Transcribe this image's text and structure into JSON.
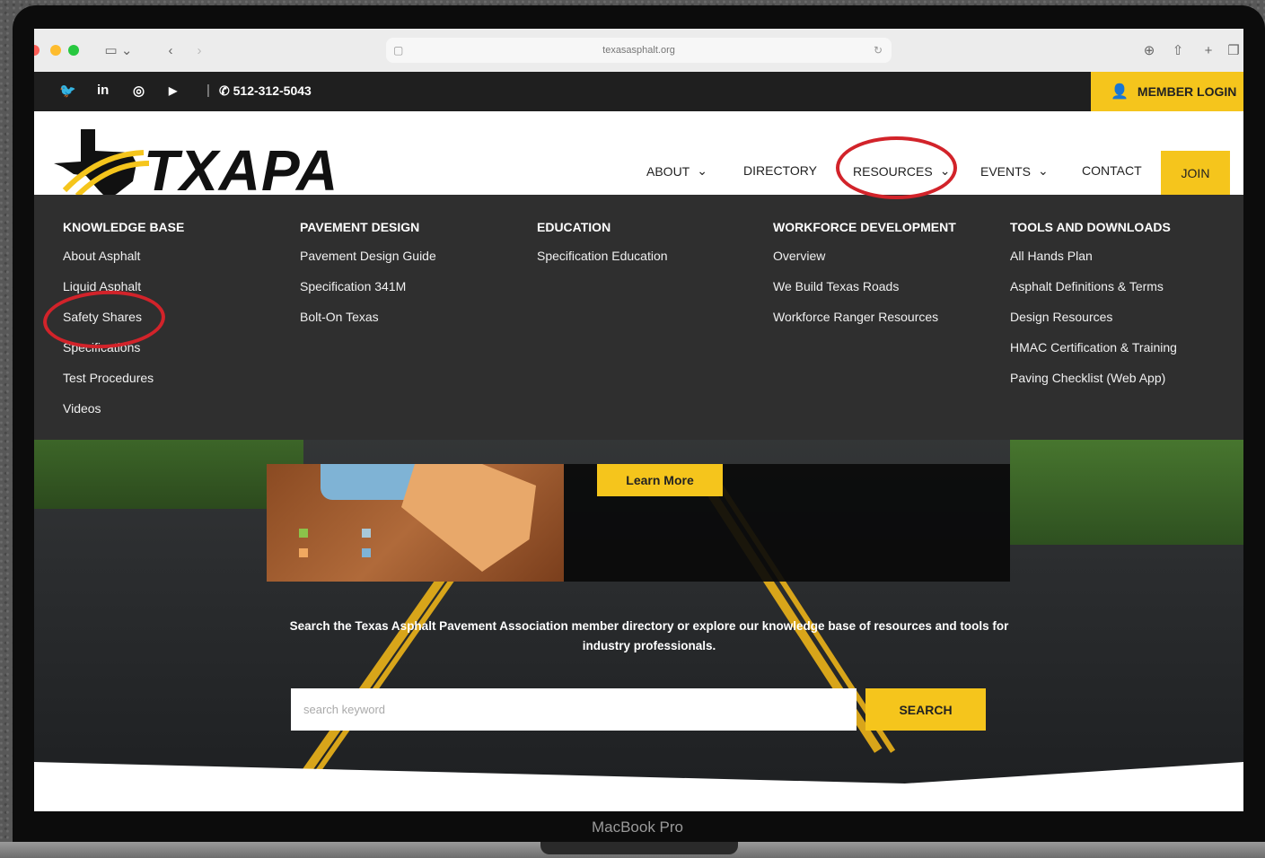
{
  "browser": {
    "url": "texasasphalt.org"
  },
  "topbar": {
    "social": [
      "twitter-icon",
      "linkedin-icon",
      "instagram-icon",
      "youtube-icon"
    ],
    "social_glyphs": [
      "🐦",
      "in",
      "◎",
      "▶"
    ],
    "separator": "|",
    "phone": "512-312-5043",
    "member_login": "MEMBER LOGIN"
  },
  "header": {
    "logo_text": "TXAPA",
    "nav": {
      "about": "ABOUT",
      "directory": "DIRECTORY",
      "resources": "RESOURCES",
      "events": "EVENTS",
      "contact": "CONTACT",
      "join": "JOIN"
    }
  },
  "mega_menu": {
    "columns": [
      {
        "heading": "KNOWLEDGE BASE",
        "links": [
          "About Asphalt",
          "Liquid Asphalt",
          "Safety Shares",
          "Specifications",
          "Test Procedures",
          "Videos"
        ]
      },
      {
        "heading": "PAVEMENT DESIGN",
        "links": [
          "Pavement Design Guide",
          "Specification 341M",
          "Bolt-On Texas"
        ]
      },
      {
        "heading": "EDUCATION",
        "links": [
          "Specification Education"
        ]
      },
      {
        "heading": "WORKFORCE DEVELOPMENT",
        "links": [
          "Overview",
          "We Build Texas Roads",
          "Workforce Ranger Resources"
        ]
      },
      {
        "heading": "TOOLS AND DOWNLOADS",
        "links": [
          "All Hands Plan",
          "Asphalt Definitions & Terms",
          "Design Resources",
          "HMAC Certification & Training",
          "Paving Checklist (Web App)"
        ]
      }
    ]
  },
  "hero": {
    "learn_more": "Learn More",
    "description": "Search the Texas Asphalt Pavement Association member directory or explore our knowledge base of resources and tools for industry professionals.",
    "search_placeholder": "search keyword",
    "search_button": "SEARCH"
  },
  "device": {
    "label": "MacBook Pro"
  },
  "colors": {
    "accent": "#f5c51c",
    "topbar": "#1f1f1f",
    "mega_menu": "#2f2f2f",
    "highlight_ring": "#d2232a"
  }
}
